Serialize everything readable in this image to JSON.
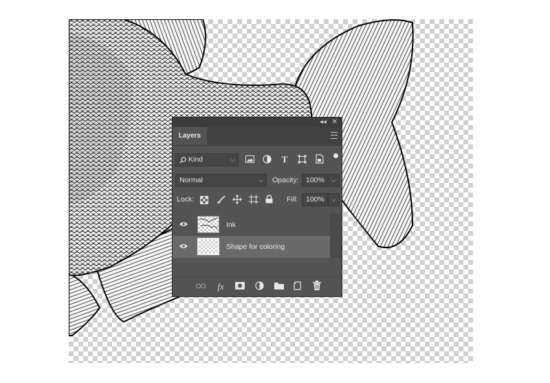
{
  "panel": {
    "collapse_icon": "◂◂",
    "close_icon": "✕",
    "tab_label": "Layers",
    "filter": {
      "kind_label": "Kind"
    },
    "blend_mode": "Normal",
    "opacity_label": "Opacity:",
    "opacity_value": "100%",
    "lock_label": "Lock:",
    "fill_label": "Fill:",
    "fill_value": "100%",
    "layers": [
      {
        "name": "Ink",
        "visible": true,
        "selected": false
      },
      {
        "name": "Shape for coloring",
        "visible": true,
        "selected": true
      }
    ]
  },
  "icons": {
    "filter_icons": [
      "image-filter-icon",
      "adjustment-filter-icon",
      "type-filter-icon",
      "shape-filter-icon",
      "smartobject-filter-icon"
    ],
    "lock_icons": [
      "lock-transparent-icon",
      "lock-paint-icon",
      "lock-position-icon",
      "lock-artboard-icon",
      "lock-all-icon"
    ],
    "bottom_icons": [
      "link-icon",
      "fx-icon",
      "mask-icon",
      "adjustment-icon",
      "folder-icon",
      "new-layer-icon",
      "trash-icon"
    ]
  },
  "text": {
    "fx": "fx",
    "T": "T"
  }
}
